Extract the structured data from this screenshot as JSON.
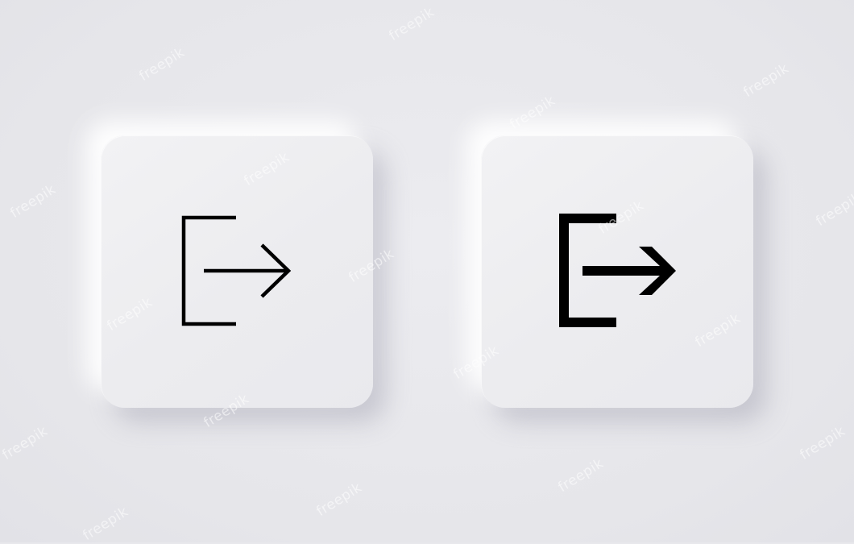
{
  "buttons": [
    {
      "icon": "logout-icon",
      "style": "thin-outline"
    },
    {
      "icon": "logout-icon",
      "style": "bold"
    }
  ],
  "colors": {
    "background": "#e8e8ec",
    "button_surface": "#efeff2",
    "icon": "#000000"
  },
  "watermark": "freepik"
}
